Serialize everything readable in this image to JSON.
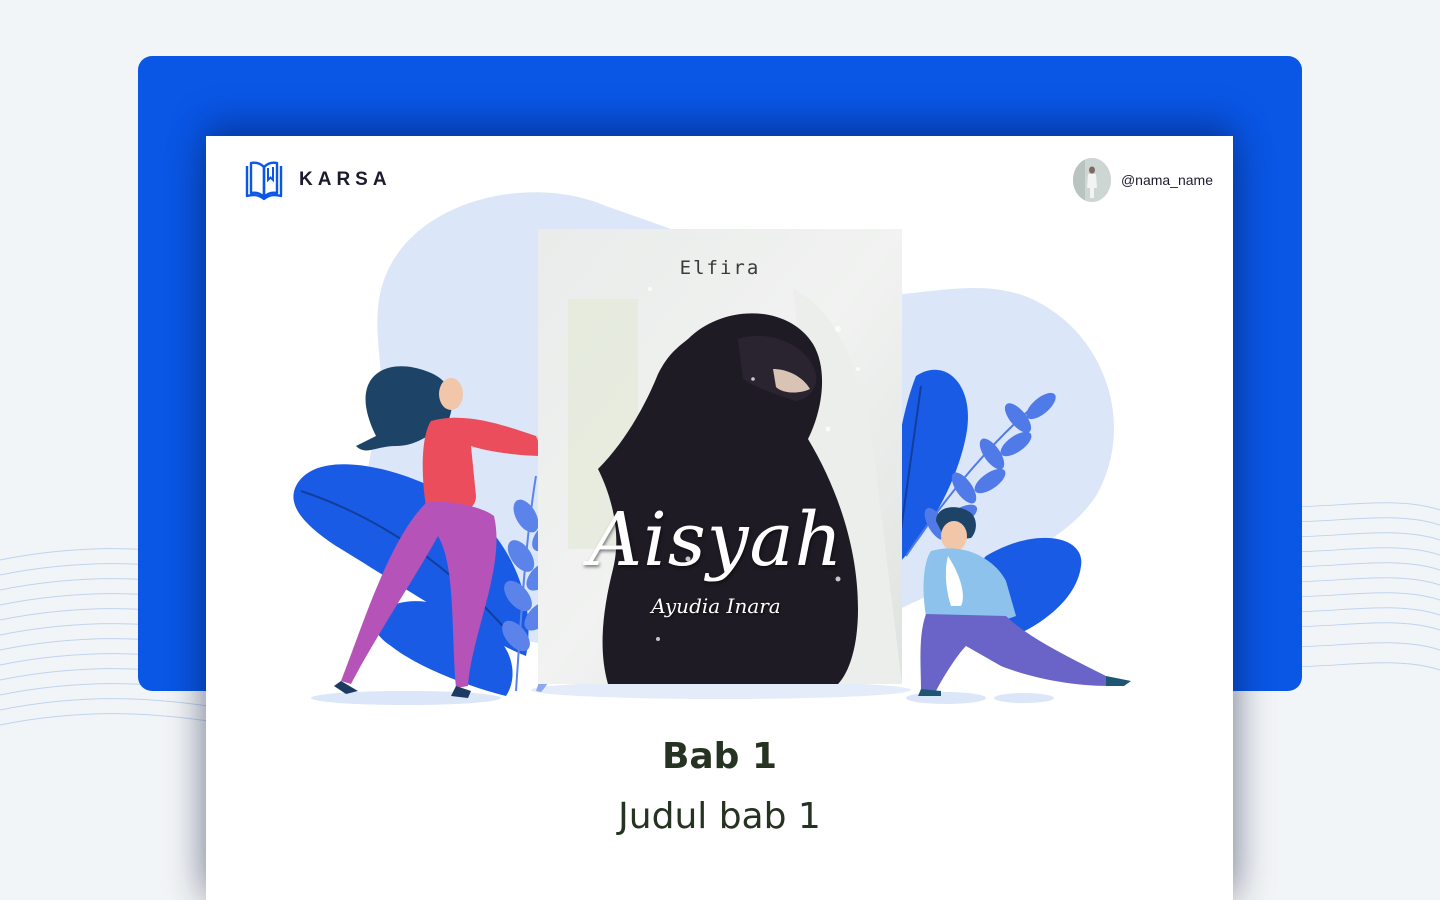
{
  "brand": {
    "name": "KARSA",
    "logo_icon": "book-icon",
    "color": "#0a57e6"
  },
  "user": {
    "username": "@nama_name",
    "avatar_icon": "avatar-image"
  },
  "cover": {
    "author": "Elfira",
    "title": "Aisyah",
    "subtitle": "Ayudia Inara"
  },
  "chapter": {
    "label": "Bab 1",
    "title": "Judul bab 1"
  },
  "colors": {
    "frame_blue": "#0a57e6",
    "blob_light": "#dbe6f8",
    "leaf_blue": "#1a5be6",
    "text_dark": "#263322"
  }
}
